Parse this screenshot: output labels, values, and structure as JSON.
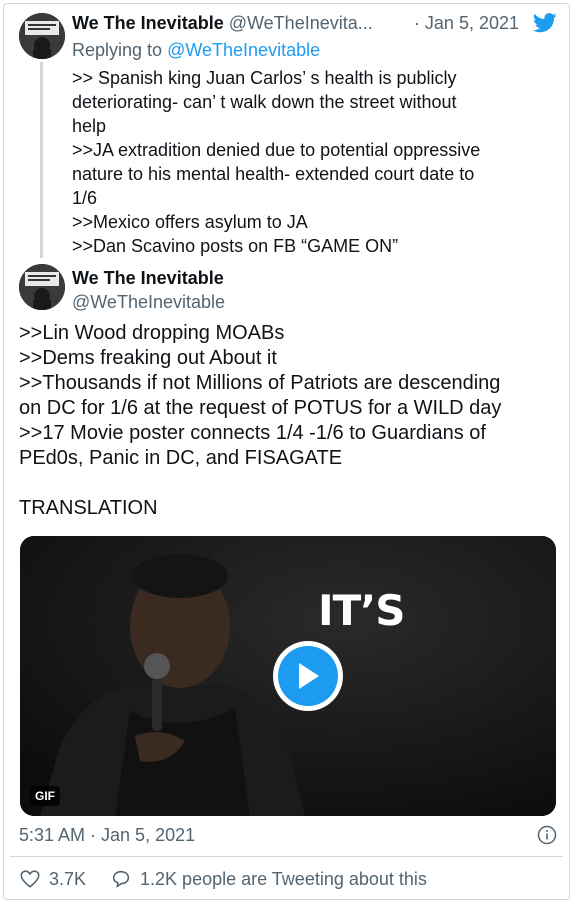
{
  "reply_tweet": {
    "display_name": "We The Inevitable",
    "handle": "@WeTheInevita...",
    "separator": "·",
    "date": "Jan 5, 2021",
    "replying_prefix": "Replying to",
    "replying_to": "@WeTheInevitable",
    "lines": [
      ">> Spanish king Juan Carlos’ s health is publicly\ndeteriorating- can’ t walk down the street without\nhelp",
      ">>JA extradition denied due to potential oppressive\nnature to his mental health- extended court date to\n1/6",
      ">>Mexico offers asylum to JA",
      ">>Dan Scavino posts on FB “GAME ON”"
    ]
  },
  "main_tweet": {
    "display_name": "We The Inevitable",
    "handle": "@WeTheInevitable",
    "lines": [
      ">>Lin Wood dropping MOABs",
      ">>Dems freaking out About it",
      ">>Thousands if not Millions of Patriots are descending\non DC for 1/6 at the request of POTUS for a WILD day",
      ">>17 Movie poster connects 1/4 -1/6 to Guardians of\nPEd0s, Panic in DC, and FISAGATE"
    ],
    "translation": "TRANSLATION",
    "media": {
      "overlay_text": "IT’S",
      "badge": "GIF",
      "play_icon": "play-icon"
    },
    "timestamp": "5:31 AM · Jan 5, 2021",
    "likes": "3.7K",
    "conversation": "1.2K people are Tweeting about this"
  },
  "icons": {
    "brand": "twitter-bird-icon",
    "like": "heart-icon",
    "reply": "speech-bubble-icon",
    "info": "info-icon"
  },
  "colors": {
    "accent": "#1d9bf0",
    "secondary_text": "#536471",
    "primary_text": "#0f1419",
    "border": "#cfd9de"
  }
}
